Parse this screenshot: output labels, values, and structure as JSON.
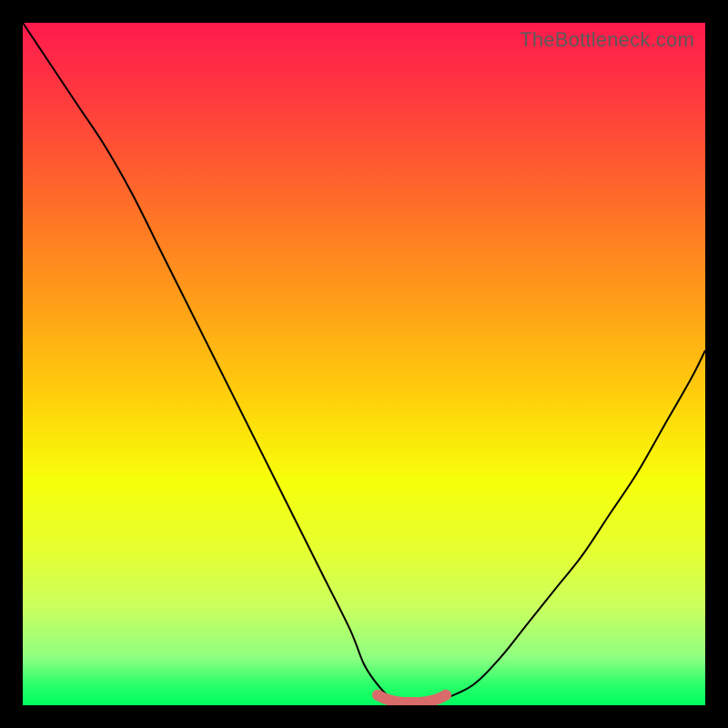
{
  "watermark": "TheBottleneck.com",
  "chart_data": {
    "type": "line",
    "title": "",
    "xlabel": "",
    "ylabel": "",
    "xlim": [
      0,
      100
    ],
    "ylim": [
      0,
      100
    ],
    "series": [
      {
        "name": "bottleneck-curve",
        "x": [
          0,
          4,
          8,
          12,
          16,
          20,
          24,
          28,
          32,
          36,
          40,
          44,
          48,
          50,
          52,
          54,
          56,
          58,
          60,
          62,
          66,
          70,
          74,
          78,
          82,
          86,
          90,
          94,
          98,
          100
        ],
        "y": [
          100,
          94,
          88,
          82,
          75,
          67,
          59,
          51,
          43,
          35,
          27,
          19,
          11,
          6,
          3,
          1,
          0,
          0,
          0,
          1,
          3,
          7,
          12,
          17,
          22,
          28,
          34,
          41,
          48,
          52
        ]
      },
      {
        "name": "optimal-zone",
        "x": [
          52,
          53,
          54,
          55,
          56,
          57,
          58,
          59,
          60,
          61,
          62
        ],
        "y": [
          1.5,
          1.0,
          0.7,
          0.5,
          0.4,
          0.4,
          0.4,
          0.5,
          0.7,
          1.0,
          1.5
        ]
      }
    ],
    "colors": {
      "curve": "#000000",
      "optimal": "#d96b6b",
      "gradient_top": "#ff1a4d",
      "gradient_bottom": "#00ff5e"
    }
  }
}
